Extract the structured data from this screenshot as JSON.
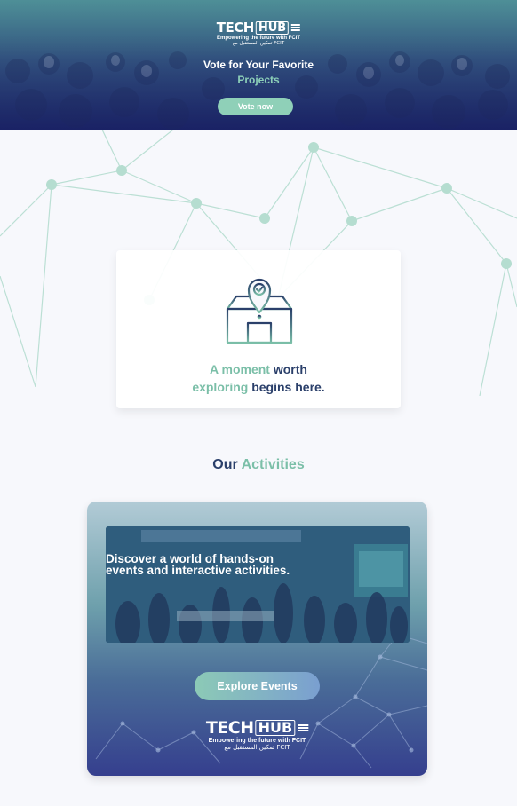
{
  "hero": {
    "logo": {
      "brand_part1": "TECH",
      "brand_part2": "HUB",
      "tagline": "Empowering the future with FCIT",
      "arabic": "تمكين المستقبل مع FCIT"
    },
    "title": "Vote for Your Favorite",
    "subtitle": "Projects",
    "vote_button": "Vote now"
  },
  "moment": {
    "line1_part1": "A moment ",
    "line1_part2": "worth",
    "line2_part1": "exploring ",
    "line2_part2": "begins here."
  },
  "activities": {
    "title_part1": "Our ",
    "title_part2": "Activities",
    "card_text": "Discover a world of hands-on events and interactive activities.",
    "explore_button": "Explore Events",
    "logo": {
      "brand_part1": "TECH",
      "brand_part2": "HUB",
      "tagline": "Empowering the future with FCIT",
      "arabic": "تمكين المستقبل مع FCIT"
    }
  },
  "colors": {
    "accent_teal": "#8fd0b8",
    "navy": "#2a3f6a",
    "background": "#f7f8fc"
  }
}
